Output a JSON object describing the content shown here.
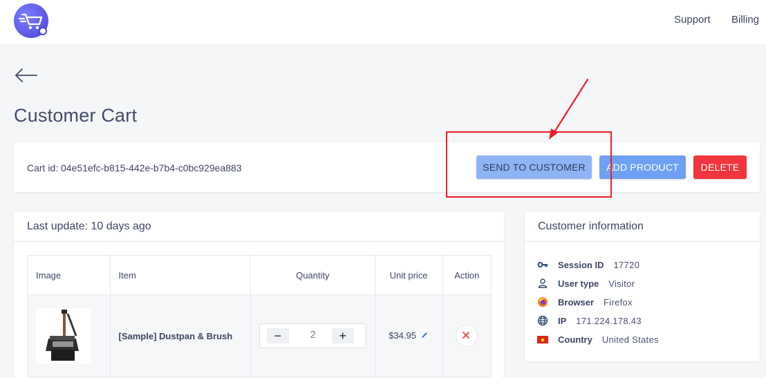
{
  "nav": {
    "support": "Support",
    "billing": "Billing"
  },
  "page": {
    "title": "Customer Cart"
  },
  "cart": {
    "cart_id": "Cart id: 04e51efc-b815-442e-b7b4-c0bc929ea883",
    "buttons": {
      "send": "SEND TO CUSTOMER",
      "add": "ADD PRODUCT",
      "delete": "DELETE"
    }
  },
  "items_card": {
    "title": "Last update: 10 days ago",
    "columns": [
      "Image",
      "Item",
      "Quantity",
      "Unit price",
      "Action"
    ],
    "rows": [
      {
        "item": "[Sample] Dustpan & Brush",
        "quantity": "2",
        "unit_price": "$34.95"
      }
    ]
  },
  "customer_info": {
    "title": "Customer information",
    "fields": [
      {
        "icon": "key-icon",
        "label": "Session ID",
        "value": "17720"
      },
      {
        "icon": "user-icon",
        "label": "User type",
        "value": "Visitor"
      },
      {
        "icon": "firefox-icon",
        "label": "Browser",
        "value": "Firefox"
      },
      {
        "icon": "globe-icon",
        "label": "IP",
        "value": "171.224.178.43"
      },
      {
        "icon": "vietnam-flag-icon",
        "label": "Country",
        "value": "United States"
      }
    ]
  },
  "colors": {
    "send_button": "#8fb4f5",
    "add_button": "#6ea0f3",
    "delete_button": "#f2353c",
    "annotation_red": "#ee1c25",
    "logo_purple": "#4b40d8"
  }
}
